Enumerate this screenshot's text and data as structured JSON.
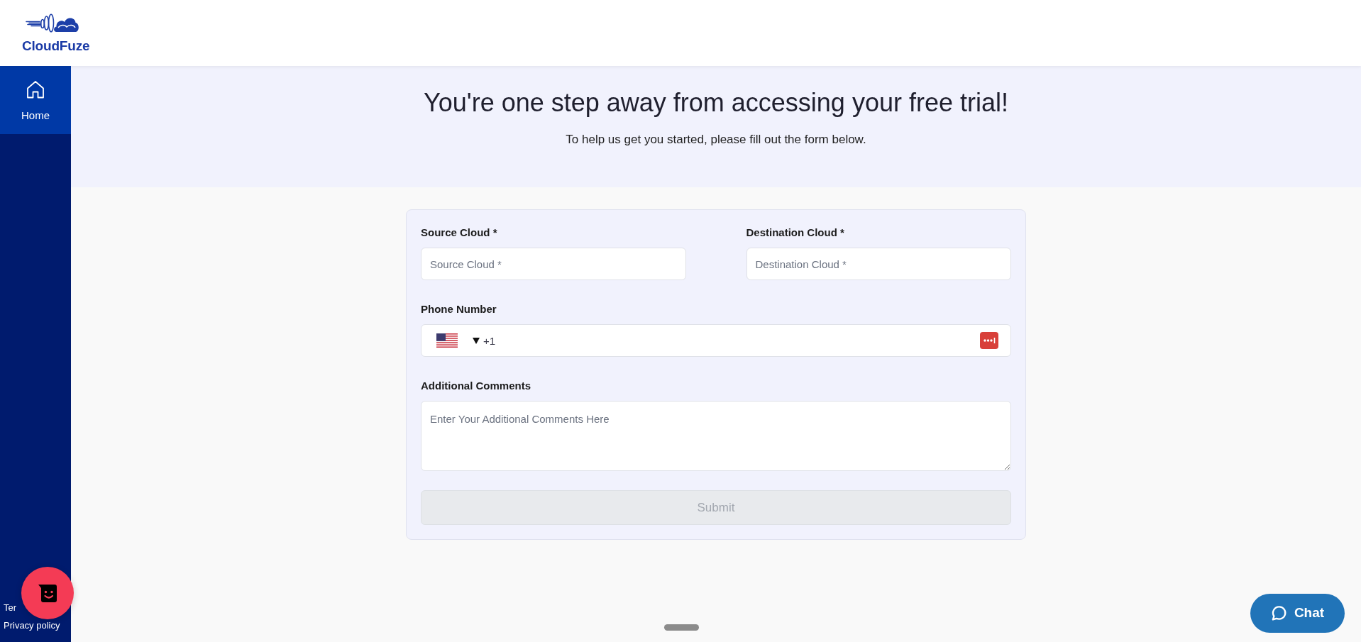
{
  "header": {
    "logo_text": "CloudFuze"
  },
  "sidebar": {
    "items": [
      {
        "label": "Home",
        "selected": true
      }
    ],
    "footer_links": [
      "Ter",
      "Privacy policy"
    ]
  },
  "banner": {
    "title": "You're one step away from accessing your free trial!",
    "subtitle": "To help us get you started, please fill out the form below."
  },
  "form": {
    "fields": [
      {
        "kind": "text",
        "label": "Source Cloud *",
        "placeholder": "Source Cloud *"
      },
      {
        "kind": "text",
        "label": "Destination Cloud *",
        "placeholder": "Destination Cloud *"
      },
      {
        "kind": "phone",
        "label": "Phone Number",
        "value": "+1"
      },
      {
        "kind": "textarea",
        "label": "Additional Comments",
        "placeholder": "Enter Your Additional Comments Here"
      }
    ],
    "submit": {
      "label": "Submit",
      "disabled": true
    }
  },
  "chat_button": {
    "label": "Chat"
  }
}
